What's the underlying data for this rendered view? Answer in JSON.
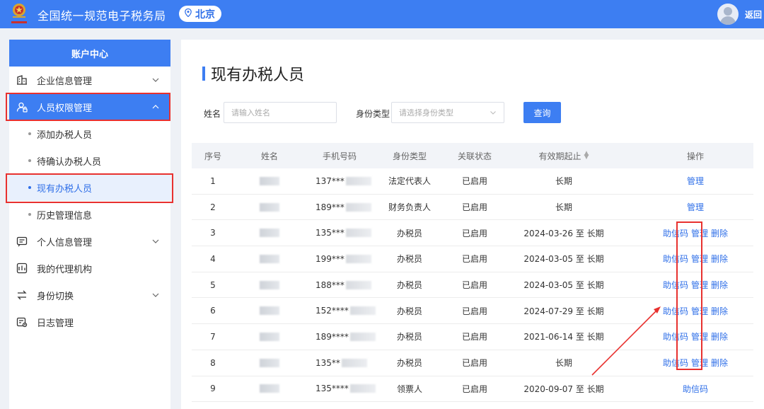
{
  "header": {
    "title": "全国统一规范电子税务局",
    "region": "北京",
    "back_label": "返回"
  },
  "sidebar": {
    "header": "账户中心",
    "items": [
      {
        "label": "企业信息管理",
        "icon": "building-icon",
        "expandable": true
      },
      {
        "label": "人员权限管理",
        "icon": "user-lock-icon",
        "expandable": true,
        "open": true
      },
      {
        "label": "添加办税人员",
        "sub": true
      },
      {
        "label": "待确认办税人员",
        "sub": true
      },
      {
        "label": "现有办税人员",
        "sub": true,
        "active": true
      },
      {
        "label": "历史管理信息",
        "sub": true
      },
      {
        "label": "个人信息管理",
        "icon": "id-card-icon",
        "expandable": true
      },
      {
        "label": "我的代理机构",
        "icon": "agency-icon",
        "expandable": false
      },
      {
        "label": "身份切换",
        "icon": "switch-icon",
        "expandable": true
      },
      {
        "label": "日志管理",
        "icon": "log-icon",
        "expandable": false
      }
    ]
  },
  "main": {
    "title": "现有办税人员",
    "filters": {
      "name_label": "姓名",
      "name_placeholder": "请输入姓名",
      "type_label": "身份类型",
      "type_placeholder": "请选择身份类型",
      "search_label": "查询"
    },
    "table": {
      "headers": [
        "序号",
        "姓名",
        "手机号码",
        "身份类型",
        "关联状态",
        "有效期起止",
        "操作"
      ],
      "rows": [
        {
          "idx": "1",
          "phone": "137***",
          "type": "法定代表人",
          "status": "已启用",
          "valid": "长期",
          "ops": [
            "管理"
          ]
        },
        {
          "idx": "2",
          "phone": "189***",
          "type": "财务负责人",
          "status": "已启用",
          "valid": "长期",
          "ops": [
            "管理"
          ]
        },
        {
          "idx": "3",
          "phone": "135***",
          "type": "办税员",
          "status": "已启用",
          "valid": "2024-03-26 至 长期",
          "ops": [
            "助信码",
            "管理",
            "删除"
          ]
        },
        {
          "idx": "4",
          "phone": "199***",
          "type": "办税员",
          "status": "已启用",
          "valid": "2024-03-05 至 长期",
          "ops": [
            "助信码",
            "管理",
            "删除"
          ]
        },
        {
          "idx": "5",
          "phone": "188***",
          "type": "办税员",
          "status": "已启用",
          "valid": "2024-03-05 至 长期",
          "ops": [
            "助信码",
            "管理",
            "删除"
          ]
        },
        {
          "idx": "6",
          "phone": "152****",
          "type": "办税员",
          "status": "已启用",
          "valid": "2024-07-29 至 长期",
          "ops": [
            "助信码",
            "管理",
            "删除"
          ]
        },
        {
          "idx": "7",
          "phone": "189****",
          "type": "办税员",
          "status": "已启用",
          "valid": "2021-06-14 至 长期",
          "ops": [
            "助信码",
            "管理",
            "删除"
          ]
        },
        {
          "idx": "8",
          "phone": "135**",
          "type": "办税员",
          "status": "已启用",
          "valid": "长期",
          "ops": [
            "助信码",
            "管理",
            "删除"
          ]
        },
        {
          "idx": "9",
          "phone": "135****",
          "type": "领票人",
          "status": "已启用",
          "valid": "2020-09-07 至 长期",
          "ops": [
            "助信码"
          ]
        }
      ]
    }
  },
  "colors": {
    "brand": "#3d7ef2",
    "highlight": "#e8312f",
    "link": "#2f6fe8"
  }
}
